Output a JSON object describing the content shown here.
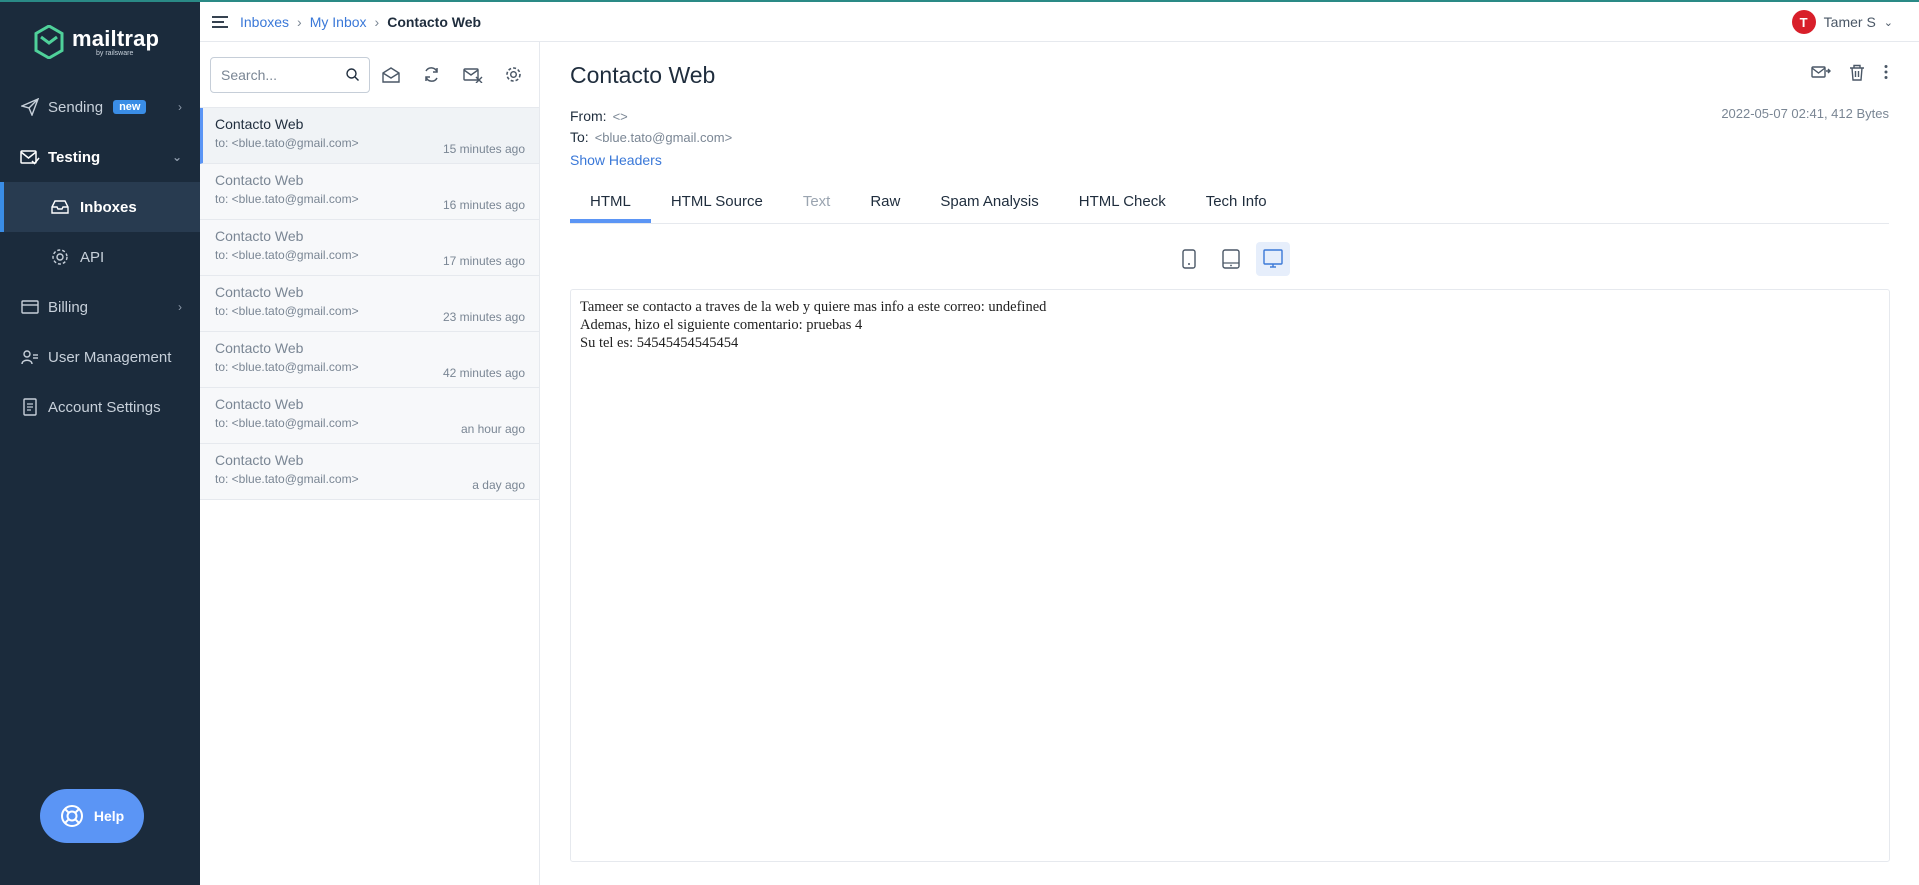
{
  "sidebar": {
    "brand": "mailtrap",
    "brand_by": "by railsware",
    "items": [
      {
        "label": "Sending",
        "badge": "new"
      },
      {
        "label": "Testing"
      },
      {
        "label": "Inboxes"
      },
      {
        "label": "API"
      },
      {
        "label": "Billing"
      },
      {
        "label": "User Management"
      },
      {
        "label": "Account Settings"
      }
    ],
    "help": "Help"
  },
  "topbar": {
    "crumbs": [
      "Inboxes",
      "My Inbox",
      "Contacto Web"
    ],
    "user": "Tamer S",
    "avatar_letter": "T"
  },
  "list": {
    "search_placeholder": "Search...",
    "messages": [
      {
        "subject": "Contacto Web",
        "to": "to: <blue.tato@gmail.com>",
        "time": "15 minutes ago"
      },
      {
        "subject": "Contacto Web",
        "to": "to: <blue.tato@gmail.com>",
        "time": "16 minutes ago"
      },
      {
        "subject": "Contacto Web",
        "to": "to: <blue.tato@gmail.com>",
        "time": "17 minutes ago"
      },
      {
        "subject": "Contacto Web",
        "to": "to: <blue.tato@gmail.com>",
        "time": "23 minutes ago"
      },
      {
        "subject": "Contacto Web",
        "to": "to: <blue.tato@gmail.com>",
        "time": "42 minutes ago"
      },
      {
        "subject": "Contacto Web",
        "to": "to: <blue.tato@gmail.com>",
        "time": "an hour ago"
      },
      {
        "subject": "Contacto Web",
        "to": "to: <blue.tato@gmail.com>",
        "time": "a day ago"
      }
    ]
  },
  "message": {
    "title": "Contacto Web",
    "from_label": "From:",
    "from_value": "<>",
    "to_label": "To:",
    "to_value": "<blue.tato@gmail.com>",
    "date": "2022-05-07 02:41, 412 Bytes",
    "show_headers": "Show Headers",
    "tabs": [
      "HTML",
      "HTML Source",
      "Text",
      "Raw",
      "Spam Analysis",
      "HTML Check",
      "Tech Info"
    ],
    "body_lines": [
      "Tameer se contacto a traves de la web y quiere mas info a este correo: undefined",
      "Ademas, hizo el siguiente comentario: pruebas 4",
      "Su tel es: 54545454545454"
    ]
  },
  "colors": {
    "sidebar_bg": "#1b2b3c",
    "accent": "#5b95f5",
    "link": "#3a78d8",
    "avatar": "#d81f2a"
  }
}
